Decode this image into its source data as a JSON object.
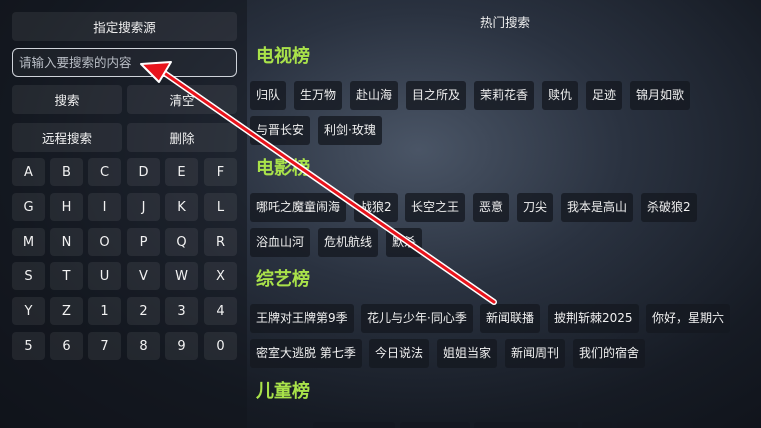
{
  "left_panel": {
    "source_button": "指定搜索源",
    "search_placeholder": "请输入要搜索的内容",
    "search_button": "搜索",
    "clear_button": "清空",
    "remote_button": "远程搜索",
    "delete_button": "删除",
    "keys": [
      "A",
      "B",
      "C",
      "D",
      "E",
      "F",
      "G",
      "H",
      "I",
      "J",
      "K",
      "L",
      "M",
      "N",
      "O",
      "P",
      "Q",
      "R",
      "S",
      "T",
      "U",
      "V",
      "W",
      "X",
      "Y",
      "Z",
      "1",
      "2",
      "3",
      "4",
      "5",
      "6",
      "7",
      "8",
      "9",
      "0"
    ]
  },
  "hot": {
    "title": "热门搜索",
    "sections": [
      {
        "title": "电视榜",
        "items": [
          "归队",
          "生万物",
          "赴山海",
          "目之所及",
          "茉莉花香",
          "赎仇",
          "足迹",
          "锦月如歌",
          "与晋长安",
          "利剑·玫瑰"
        ]
      },
      {
        "title": "电影榜",
        "items": [
          "哪吒之魔童闹海",
          "战狼2",
          "长空之王",
          "恶意",
          "刀尖",
          "我本是高山",
          "杀破狼2",
          "浴血山河",
          "危机航线",
          "默杀"
        ]
      },
      {
        "title": "综艺榜",
        "items": [
          "王牌对王牌第9季",
          "花儿与少年·同心季",
          "新闻联播",
          "披荆斩棘2025",
          "你好，星期六",
          "密室大逃脱 第七季",
          "今日说法",
          "姐姐当家",
          "新闻周刊",
          "我们的宿舍"
        ]
      },
      {
        "title": "儿童榜",
        "items": []
      }
    ]
  },
  "colors": {
    "section_title": "#a9e24a",
    "arrow": "#e8141c"
  }
}
